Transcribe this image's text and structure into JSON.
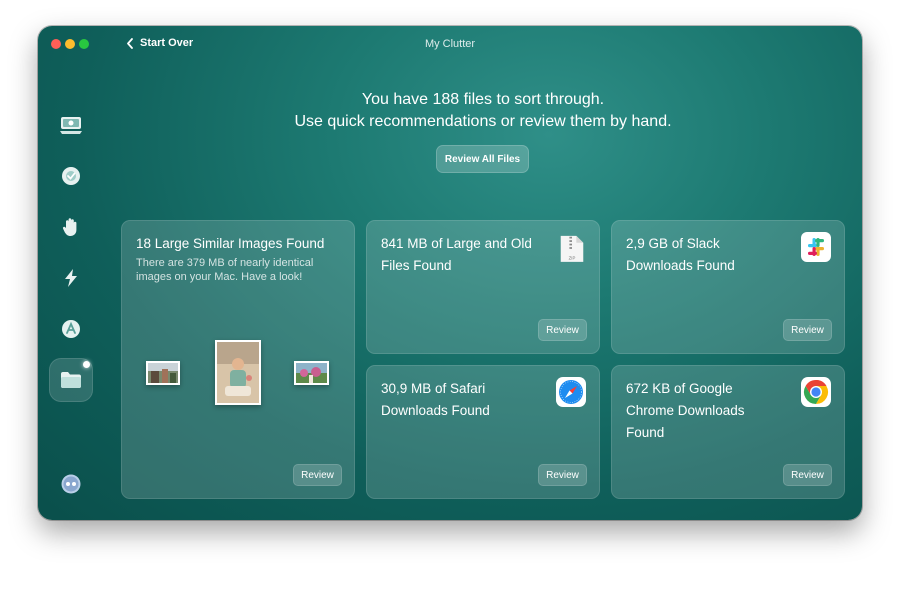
{
  "window": {
    "title": "My Clutter",
    "back_label": "Start Over"
  },
  "sidebar": {
    "items": [
      {
        "icon": "disk-icon"
      },
      {
        "icon": "protection-icon"
      },
      {
        "icon": "hand-icon"
      },
      {
        "icon": "speed-icon"
      },
      {
        "icon": "applications-icon"
      },
      {
        "icon": "folder-icon",
        "active": true
      },
      {
        "icon": "assistant-icon"
      }
    ]
  },
  "header": {
    "line1": "You have 188 files to sort through.",
    "line2": "Use quick recommendations or review them by hand.",
    "review_all_label": "Review All Files"
  },
  "cards": {
    "images": {
      "title": "18 Large Similar Images Found",
      "description": "There are 379 MB of nearly identical images on your Mac. Have a look!",
      "button": "Review"
    },
    "large_old": {
      "title_line1": "841 MB of Large and Old",
      "title_line2": "Files Found",
      "icon_label": "ZIP",
      "button": "Review"
    },
    "slack": {
      "title_line1": "2,9 GB of Slack",
      "title_line2": "Downloads Found",
      "button": "Review"
    },
    "safari": {
      "title_line1": "30,9 MB of Safari",
      "title_line2": "Downloads Found",
      "button": "Review"
    },
    "chrome": {
      "title_line1": "672 KB of Google",
      "title_line2": "Chrome Downloads",
      "title_line3": "Found",
      "button": "Review"
    }
  },
  "colors": {
    "background_accent": "#1d7a72",
    "slack_purple": "#4a154b",
    "safari_blue": "#1e8cf0"
  }
}
